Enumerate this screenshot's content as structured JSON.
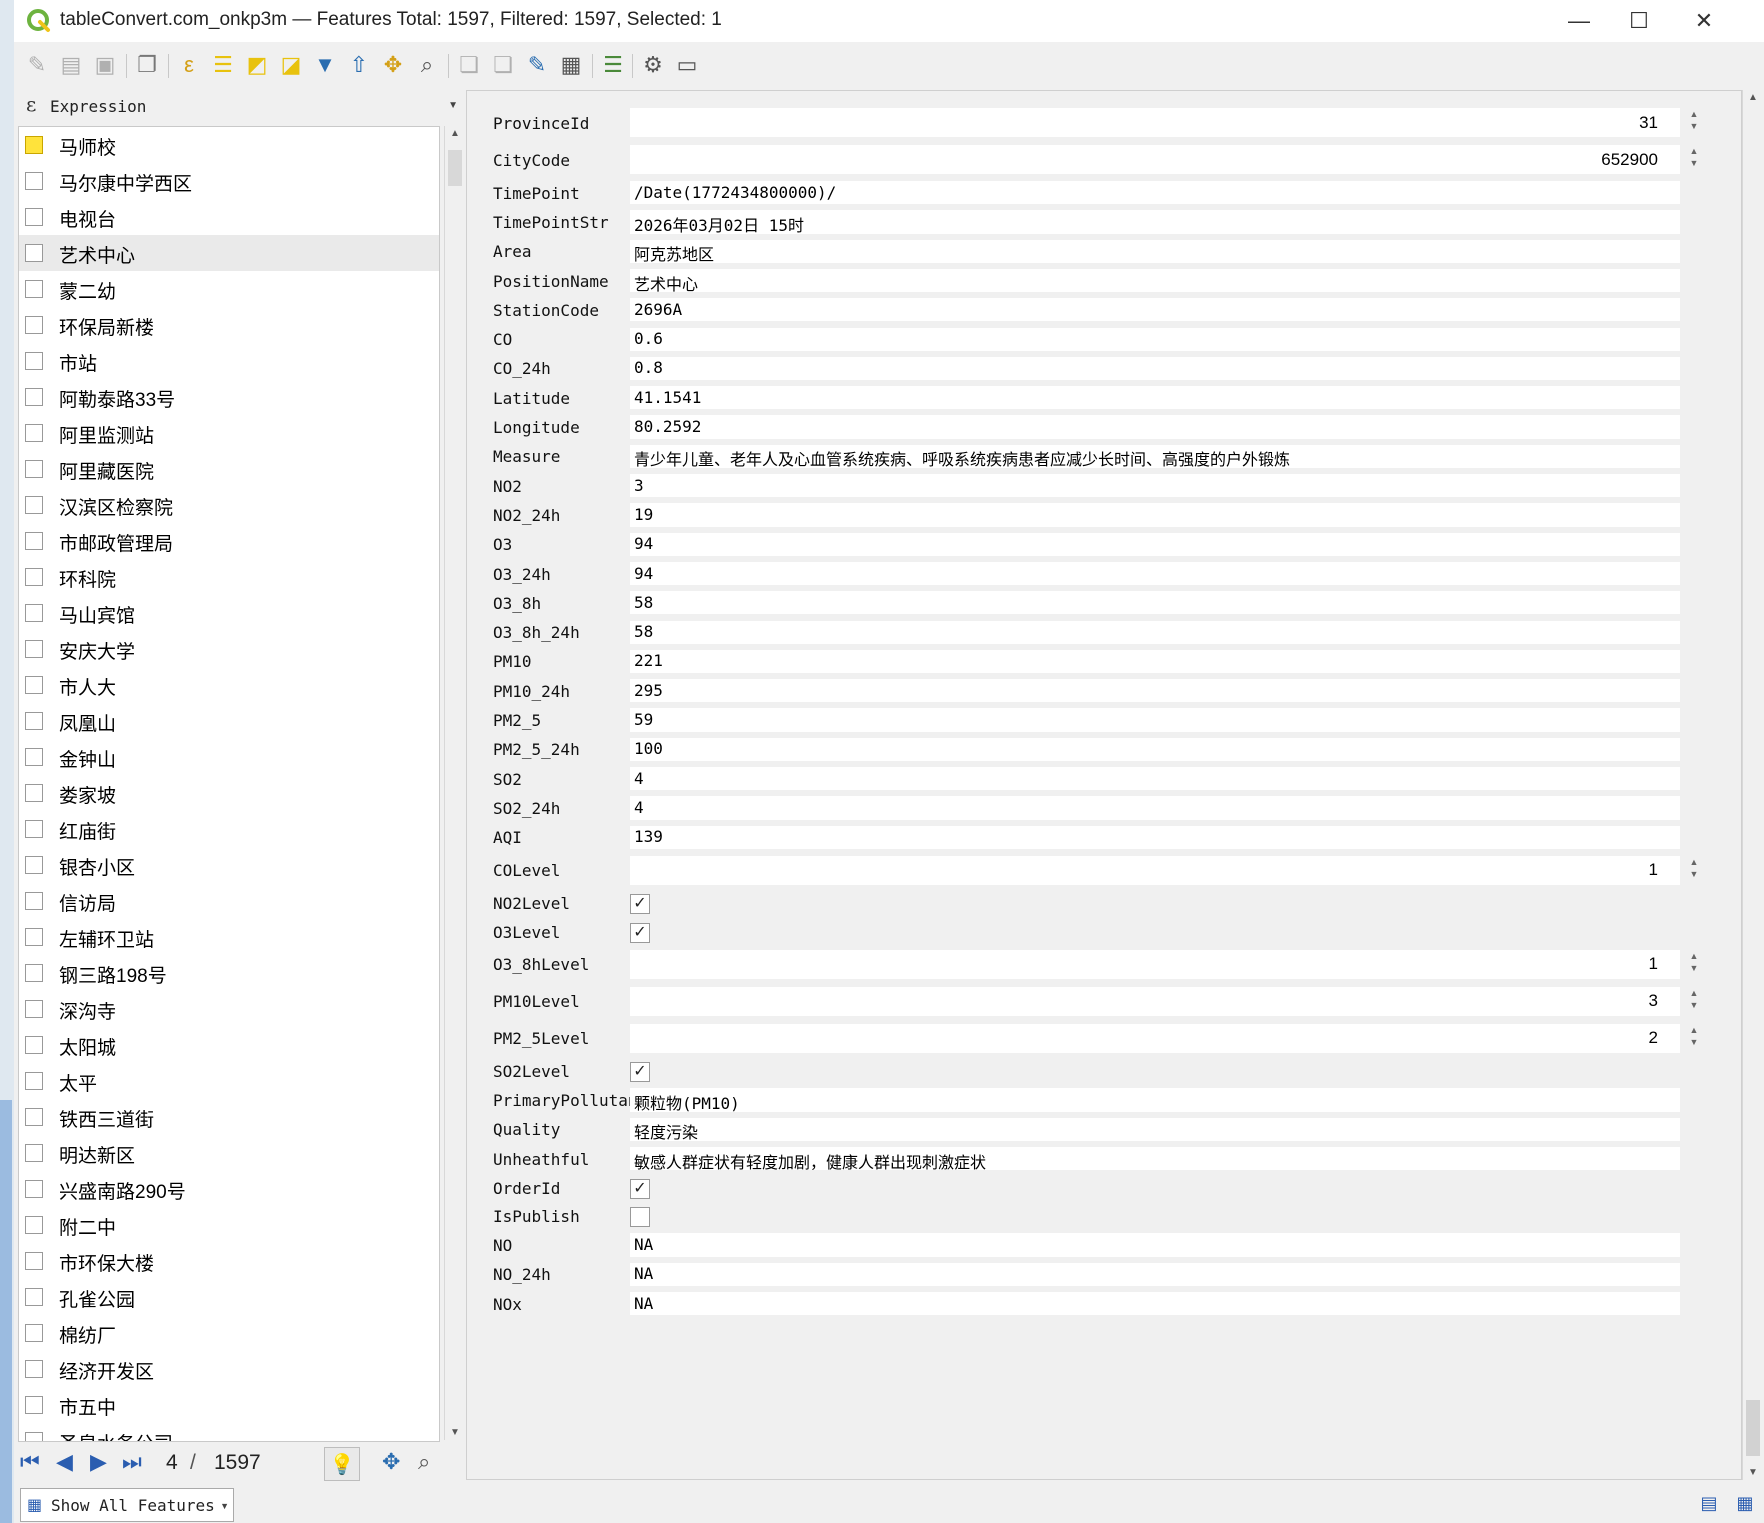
{
  "window": {
    "title": "tableConvert.com_onkp3m — Features Total: 1597, Filtered: 1597, Selected: 1",
    "minimize": "—",
    "maximize": "☐",
    "close": "✕"
  },
  "expression": {
    "label": "Expression"
  },
  "list": {
    "items": [
      "马师校",
      "马尔康中学西区",
      "电视台",
      "艺术中心",
      "蒙二幼",
      "环保局新楼",
      "市站",
      "阿勒泰路33号",
      "阿里监测站",
      "阿里藏医院",
      "汉滨区检察院",
      "市邮政管理局",
      "环科院",
      "马山宾馆",
      "安庆大学",
      "市人大",
      "凤凰山",
      "金钟山",
      "娄家坡",
      "红庙街",
      "银杏小区",
      "信访局",
      "左辅环卫站",
      "钢三路198号",
      "深沟寺",
      "太阳城",
      "太平",
      "铁西三道街",
      "明达新区",
      "兴盛南路290号",
      "附二中",
      "市环保大楼",
      "孔雀公园",
      "棉纺厂",
      "经济开发区",
      "市五中",
      "圣泉水务公司"
    ],
    "selected_index": 0,
    "highlight_index": 3
  },
  "nav": {
    "current": "4",
    "separator": "/",
    "total": "1597"
  },
  "show_all": "Show All Features",
  "form": {
    "rows": [
      {
        "label": "ProvinceId",
        "type": "num",
        "value": "31"
      },
      {
        "label": "CityCode",
        "type": "num",
        "value": "652900"
      },
      {
        "label": "TimePoint",
        "type": "text",
        "value": "/Date(1772434800000)/"
      },
      {
        "label": "TimePointStr",
        "type": "text",
        "value": "2026年03月02日 15时"
      },
      {
        "label": "Area",
        "type": "text",
        "value": "阿克苏地区"
      },
      {
        "label": "PositionName",
        "type": "text",
        "value": "艺术中心"
      },
      {
        "label": "StationCode",
        "type": "text",
        "value": "2696A"
      },
      {
        "label": "CO",
        "type": "text",
        "value": "0.6"
      },
      {
        "label": "CO_24h",
        "type": "text",
        "value": "0.8"
      },
      {
        "label": "Latitude",
        "type": "text",
        "value": "41.1541"
      },
      {
        "label": "Longitude",
        "type": "text",
        "value": "80.2592"
      },
      {
        "label": "Measure",
        "type": "text",
        "value": "青少年儿童、老年人及心血管系统疾病、呼吸系统疾病患者应减少长时间、高强度的户外锻炼"
      },
      {
        "label": "NO2",
        "type": "text",
        "value": "3"
      },
      {
        "label": "NO2_24h",
        "type": "text",
        "value": "19"
      },
      {
        "label": "O3",
        "type": "text",
        "value": "94"
      },
      {
        "label": "O3_24h",
        "type": "text",
        "value": "94"
      },
      {
        "label": "O3_8h",
        "type": "text",
        "value": "58"
      },
      {
        "label": "O3_8h_24h",
        "type": "text",
        "value": "58"
      },
      {
        "label": "PM10",
        "type": "text",
        "value": "221"
      },
      {
        "label": "PM10_24h",
        "type": "text",
        "value": "295"
      },
      {
        "label": "PM2_5",
        "type": "text",
        "value": "59"
      },
      {
        "label": "PM2_5_24h",
        "type": "text",
        "value": "100"
      },
      {
        "label": "SO2",
        "type": "text",
        "value": "4"
      },
      {
        "label": "SO2_24h",
        "type": "text",
        "value": "4"
      },
      {
        "label": "AQI",
        "type": "text",
        "value": "139"
      },
      {
        "label": "COLevel",
        "type": "num",
        "value": "1"
      },
      {
        "label": "NO2Level",
        "type": "check",
        "checked": true
      },
      {
        "label": "O3Level",
        "type": "check",
        "checked": true
      },
      {
        "label": "O3_8hLevel",
        "type": "num",
        "value": "1"
      },
      {
        "label": "PM10Level",
        "type": "num",
        "value": "3"
      },
      {
        "label": "PM2_5Level",
        "type": "num",
        "value": "2"
      },
      {
        "label": "SO2Level",
        "type": "check",
        "checked": true
      },
      {
        "label": "PrimaryPollutant",
        "type": "text",
        "value": "颗粒物(PM10)"
      },
      {
        "label": "Quality",
        "type": "text",
        "value": "轻度污染"
      },
      {
        "label": "Unheathful",
        "type": "text",
        "value": "敏感人群症状有轻度加剧，健康人群出现刺激症状"
      },
      {
        "label": "OrderId",
        "type": "check",
        "checked": true
      },
      {
        "label": "IsPublish",
        "type": "check",
        "checked": false
      },
      {
        "label": "NO",
        "type": "text",
        "value": "NA"
      },
      {
        "label": "NO_24h",
        "type": "text",
        "value": "NA"
      },
      {
        "label": "NOx",
        "type": "text",
        "value": "NA"
      }
    ]
  },
  "icons": {
    "check_mark": "✓",
    "spin_up": "▲",
    "spin_down": "▼"
  }
}
